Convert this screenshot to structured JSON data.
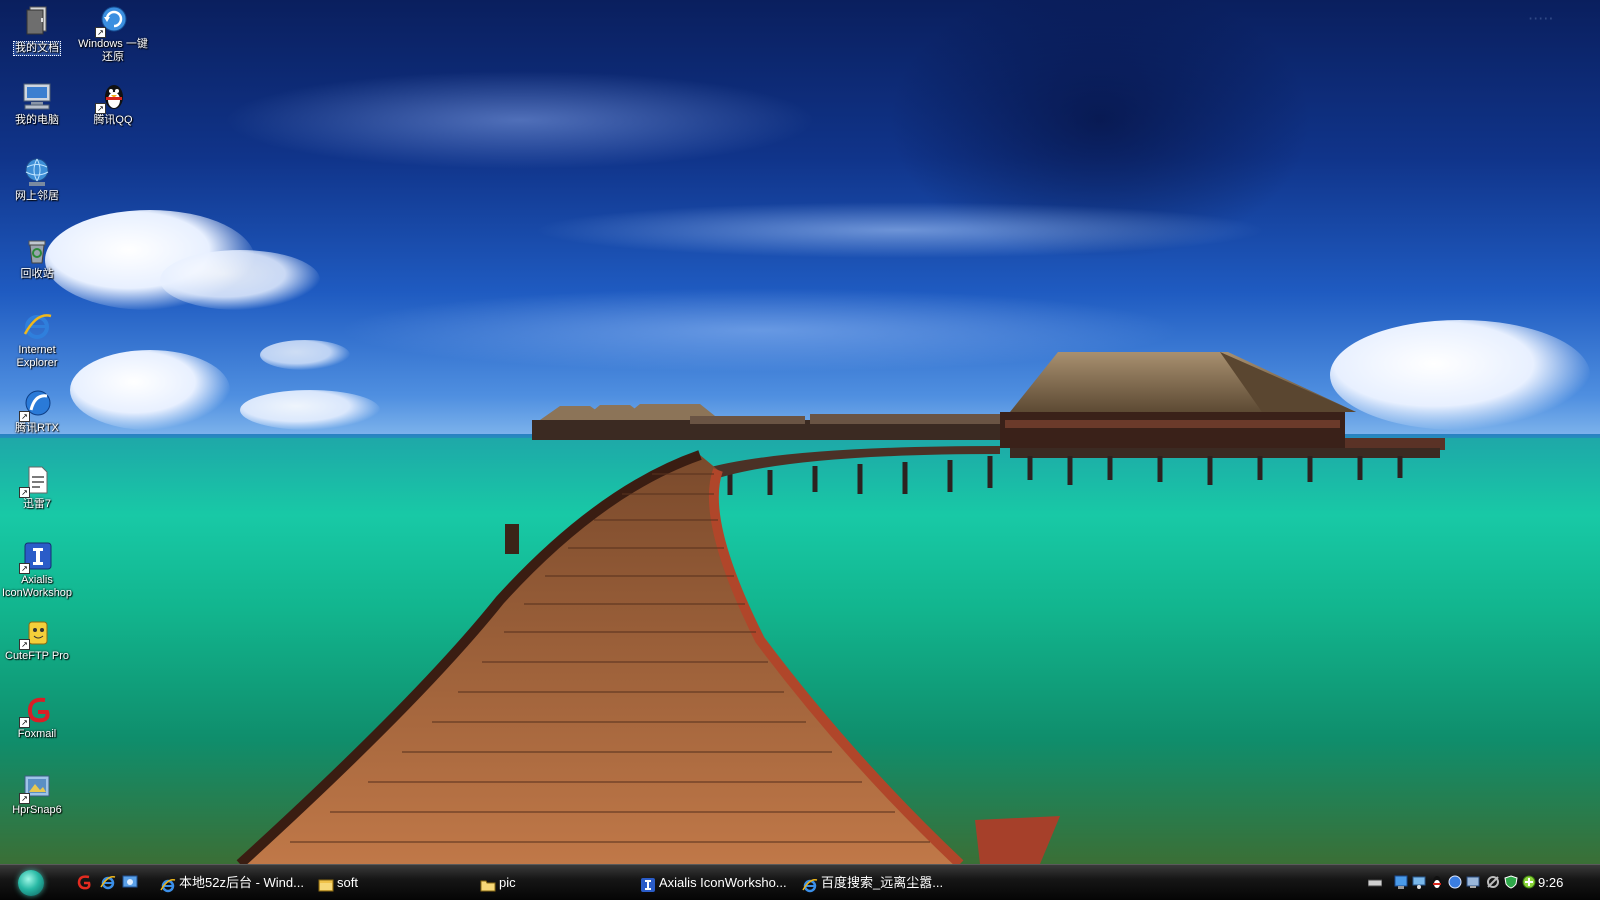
{
  "desktop": {
    "icons_col1": [
      {
        "label": "我的文档",
        "icon": "folder-documents-icon"
      },
      {
        "label": "我的电脑",
        "icon": "computer-icon"
      },
      {
        "label": "网上邻居",
        "icon": "network-globe-icon"
      },
      {
        "label": "回收站",
        "icon": "recycle-bin-icon"
      },
      {
        "label": "Internet Explorer",
        "icon": "internet-explorer-icon"
      },
      {
        "label": "腾讯RTX",
        "icon": "rtx-icon"
      },
      {
        "label": "迅雷7",
        "icon": "thunder-document-icon"
      },
      {
        "label": "Axialis IconWorkshop",
        "icon": "axialis-icon"
      },
      {
        "label": "CuteFTP Pro",
        "icon": "cuteftp-icon"
      },
      {
        "label": "Foxmail",
        "icon": "foxmail-icon"
      },
      {
        "label": "HprSnap6",
        "icon": "hypersnap-icon"
      }
    ],
    "icons_col2": [
      {
        "label": "Windows 一键还原",
        "icon": "restore-icon"
      },
      {
        "label": "腾讯QQ",
        "icon": "qq-penguin-icon"
      }
    ]
  },
  "taskbar": {
    "quick_launch": [
      "red-swirl-icon",
      "internet-explorer-icon",
      "show-desktop-icon"
    ],
    "tasks": [
      {
        "label": "本地52z后台 - Wind...",
        "icon": "internet-explorer-icon"
      },
      {
        "label": "soft",
        "icon": "folder-icon"
      },
      {
        "label": "pic",
        "icon": "folder-icon"
      },
      {
        "label": "Axialis IconWorksho...",
        "icon": "axialis-icon"
      },
      {
        "label": "百度搜索_远离尘嚣...",
        "icon": "internet-explorer-icon"
      }
    ],
    "tray": [
      "keyboard-icon",
      "network-icon",
      "monitor-icon",
      "qq-icon",
      "globe-icon",
      "volume-icon",
      "network-connection-icon",
      "shield-icon",
      "green-status-icon"
    ],
    "clock": "9:26"
  },
  "colors": {
    "taskbar_bg": "#0a0a0a",
    "icon_label": "#ffffff"
  }
}
